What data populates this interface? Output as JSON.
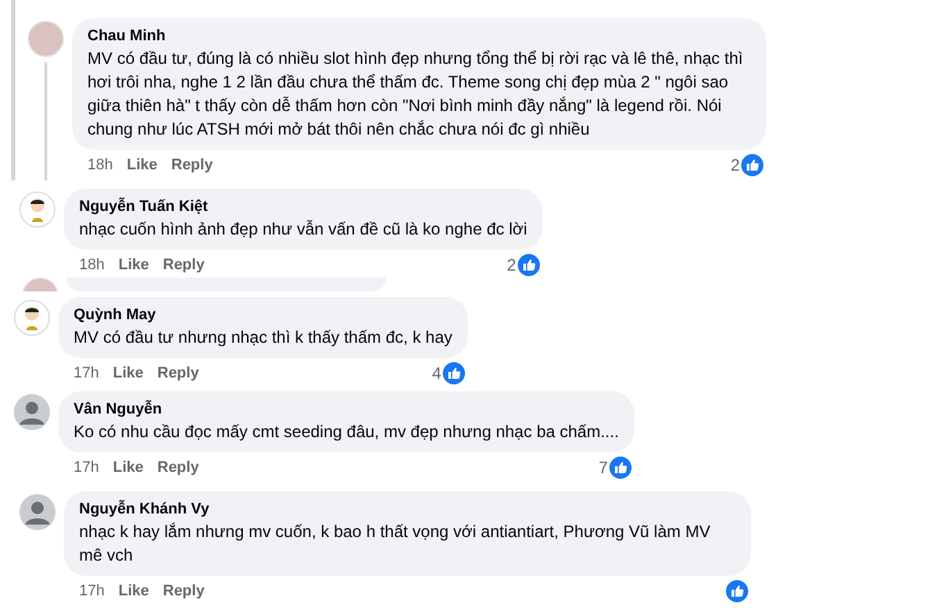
{
  "comments": [
    {
      "kind": "thread",
      "avatar": {
        "kind": "photo"
      },
      "name": "Chau Minh",
      "text": "MV có đầu tư, đúng là có nhiều slot hình đẹp nhưng tổng thể bị rời rạc và lê thê, nhạc thì hơi trôi nha, nghe 1 2 lần đầu chưa thể thấm đc. Theme song chị đẹp mùa 2 \" ngôi sao giữa thiên hà\" t thấy còn dễ thấm hơn còn \"Nơi bình minh đầy nắng\" là legend rồi. Nói chung như lúc ATSH mới mở bát thôi nên chắc chưa nói đc gì nhiều",
      "time": "18h",
      "like": "Like",
      "reply": "Reply",
      "likes": "2"
    },
    {
      "kind": "plain",
      "avatar": {
        "kind": "cartoon"
      },
      "name": "Nguyễn Tuấn Kiệt",
      "text": "nhạc cuốn hình ảnh đẹp như vẫn vấn đề cũ là ko nghe đc lời",
      "time": "18h",
      "like": "Like",
      "reply": "Reply",
      "likes": "2"
    },
    {
      "kind": "cut",
      "avatar": {
        "kind": "photo"
      }
    },
    {
      "kind": "plain",
      "avatar": {
        "kind": "cartoon"
      },
      "name": "Quỳnh May",
      "text": "MV có đầu tư nhưng nhạc thì k thấy thấm đc, k hay",
      "time": "17h",
      "like": "Like",
      "reply": "Reply",
      "likes": "4"
    },
    {
      "kind": "plain",
      "avatar": {
        "kind": "default"
      },
      "name": "Vân Nguyễn",
      "text": "Ko có nhu cầu đọc mấy cmt seeding đâu, mv đẹp nhưng nhạc ba chấm....",
      "time": "17h",
      "like": "Like",
      "reply": "Reply",
      "likes": "7"
    },
    {
      "kind": "plain",
      "avatar": {
        "kind": "default"
      },
      "name": "Nguyễn Khánh Vy",
      "text": "nhạc k hay lắm nhưng mv cuốn, k bao h thất vọng với antiantiart, Phương Vũ làm MV mê vch",
      "time": "17h",
      "like": "Like",
      "reply": "Reply"
    }
  ]
}
